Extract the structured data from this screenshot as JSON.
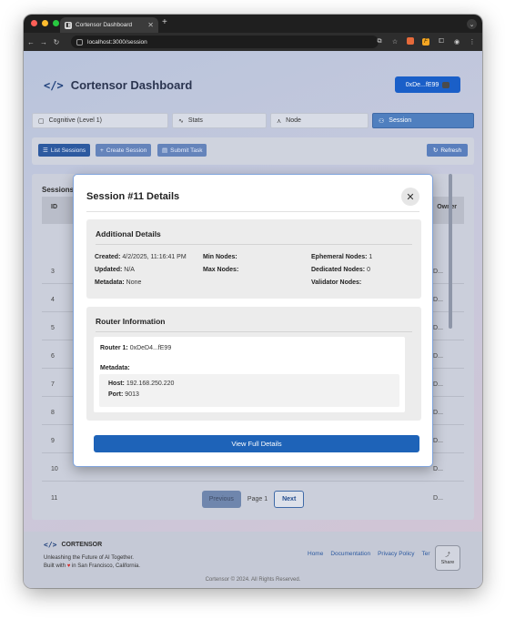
{
  "browser": {
    "tab_title": "Cortensor Dashboard",
    "tab_close": "✕",
    "new_tab": "+",
    "url": "localhost:3000/session"
  },
  "header": {
    "logo_mark": "</>",
    "title": "Cortensor Dashboard",
    "wallet": "0xDe...fE99"
  },
  "nav_tabs": [
    {
      "label": "Cognitive (Level 1)",
      "icon": "box-icon"
    },
    {
      "label": "Stats",
      "icon": "activity-icon"
    },
    {
      "label": "Node",
      "icon": "network-icon"
    },
    {
      "label": "Session",
      "icon": "users-icon"
    }
  ],
  "actions": {
    "list_sessions": "List Sessions",
    "create_session": "Create Session",
    "submit_task": "Submit Task",
    "refresh": "Refresh"
  },
  "table": {
    "title": "Sessions",
    "col_id": "ID",
    "col_owner": "Owner",
    "rows": [
      {
        "id": "3",
        "owner": "D..."
      },
      {
        "id": "4",
        "owner": "D..."
      },
      {
        "id": "5",
        "owner": "D..."
      },
      {
        "id": "6",
        "owner": "D..."
      },
      {
        "id": "7",
        "owner": "D..."
      },
      {
        "id": "8",
        "owner": "D..."
      },
      {
        "id": "9",
        "owner": "D..."
      },
      {
        "id": "10",
        "owner": "D..."
      },
      {
        "id": "11",
        "owner": "D..."
      }
    ]
  },
  "pagination": {
    "previous": "Previous",
    "page_label": "Page 1",
    "next": "Next"
  },
  "footer": {
    "logo_mark": "</>",
    "brand": "CORTENSOR",
    "tagline": "Unleashing the Future of AI Together.",
    "built_prefix": "Built with",
    "built_suffix": "in San Francisco, California.",
    "links": [
      "Home",
      "Documentation",
      "Privacy Policy",
      "Ter"
    ],
    "share": "Share",
    "copyright": "Cortensor © 2024. All Rights Reserved."
  },
  "modal": {
    "title": "Session #11 Details",
    "close": "✕",
    "additional": {
      "heading": "Additional Details",
      "created_label": "Created:",
      "created_value": "4/2/2025, 11:16:41 PM",
      "updated_label": "Updated:",
      "updated_value": "N/A",
      "metadata_label": "Metadata:",
      "metadata_value": "None",
      "min_nodes_label": "Min Nodes:",
      "max_nodes_label": "Max Nodes:",
      "ephemeral_label": "Ephemeral Nodes:",
      "ephemeral_value": "1",
      "dedicated_label": "Dedicated Nodes:",
      "dedicated_value": "0",
      "validator_label": "Validator Nodes:"
    },
    "router": {
      "heading": "Router Information",
      "router1_label": "Router 1:",
      "router1_value": "0xDeD4...fE99",
      "metadata_label": "Metadata:",
      "host_label": "Host:",
      "host_value": "192.168.250.220",
      "port_label": "Port:",
      "port_value": "9013"
    },
    "view_button": "View Full Details"
  },
  "colors": {
    "accent": "#1e63b8",
    "active_tab": "#4f7fbf"
  }
}
